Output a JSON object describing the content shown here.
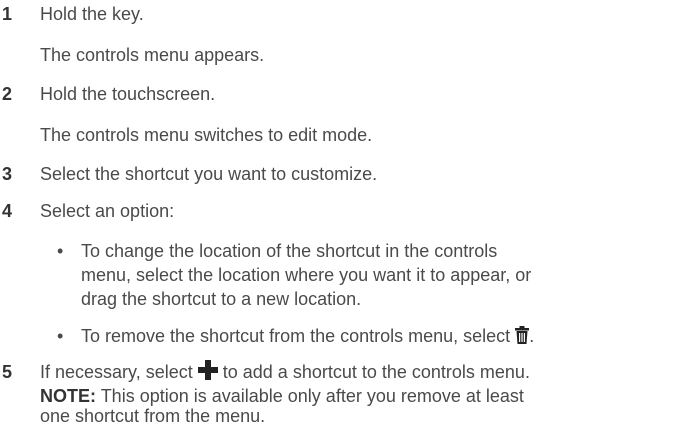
{
  "steps": [
    {
      "number": "1",
      "text": "Hold the key.",
      "result": "The controls menu appears."
    },
    {
      "number": "2",
      "text": "Hold the touchscreen.",
      "result": "The controls menu switches to edit mode."
    },
    {
      "number": "3",
      "text": "Select the shortcut you want to customize."
    },
    {
      "number": "4",
      "text": "Select an option:",
      "bullets": [
        {
          "lines": [
            "To change the location of the shortcut in the controls",
            "menu, select the location where you want it to appear, or",
            "drag the shortcut to a new location."
          ]
        },
        {
          "text_before_icon": "To remove the shortcut from the controls menu, select",
          "icon": "trash-icon",
          "text_after_icon": "."
        }
      ]
    },
    {
      "number": "5",
      "text_before_icon": "If necessary, select",
      "icon": "plus-icon",
      "text_after_icon": "to add a shortcut to the controls menu.",
      "note": {
        "label": "NOTE:",
        "lines": [
          "This option is available only after you remove at least",
          "one shortcut from the menu."
        ]
      }
    }
  ],
  "colors": {
    "text": "#4a4a4a",
    "number": "#333333",
    "icon": "#222222"
  }
}
